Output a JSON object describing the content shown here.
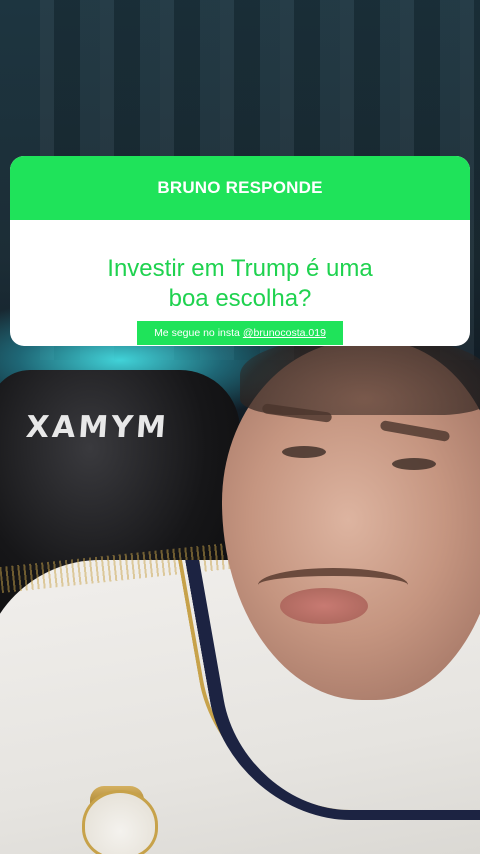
{
  "card": {
    "header": "BRUNO RESPONDE",
    "question_line1": "Investir em Trump é uma",
    "question_line2": "boa escolha?",
    "follow_text": "Me segue no insta",
    "follow_handle": "@brunocosta.019"
  },
  "background": {
    "chair_logo": "XAMYM"
  },
  "colors": {
    "accent_green": "#1fe35a",
    "question_green": "#1fd24f",
    "card_bg": "#ffffff"
  }
}
